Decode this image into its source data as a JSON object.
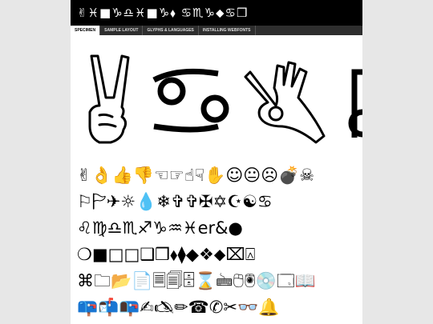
{
  "header": {
    "title": "✌︎♓︎■︎♑︎♎︎♓︎■︎♑︎⬧︎ ♋︎♏︎♑︎⬥︎♋︎❒︎"
  },
  "tabs": [
    {
      "label": "SPECIMEN",
      "active": true
    },
    {
      "label": "SAMPLE LAYOUT",
      "active": false
    },
    {
      "label": "GLYPHS & LANGUAGES",
      "active": false
    },
    {
      "label": "INSTALLING WEBFONTS",
      "active": false
    }
  ],
  "glyph_rows": [
    "✌👌👍👎☜☞☝☟✋☺😐☹💣☠",
    "⚐🏱✈☼💧❄✞✞✠✡☪☯♋",
    "♌♍♎♏♐♑♒♓er&●",
    "❍■□□❑❒⬧⧫◆❖⬥⌧⍓",
    "⌘🗀📂📄🗏🗐🗄⌛🖮🖰🖲💿🗔📖",
    "📪📬📭✍🖎✏☎✆✂👓🔔"
  ]
}
